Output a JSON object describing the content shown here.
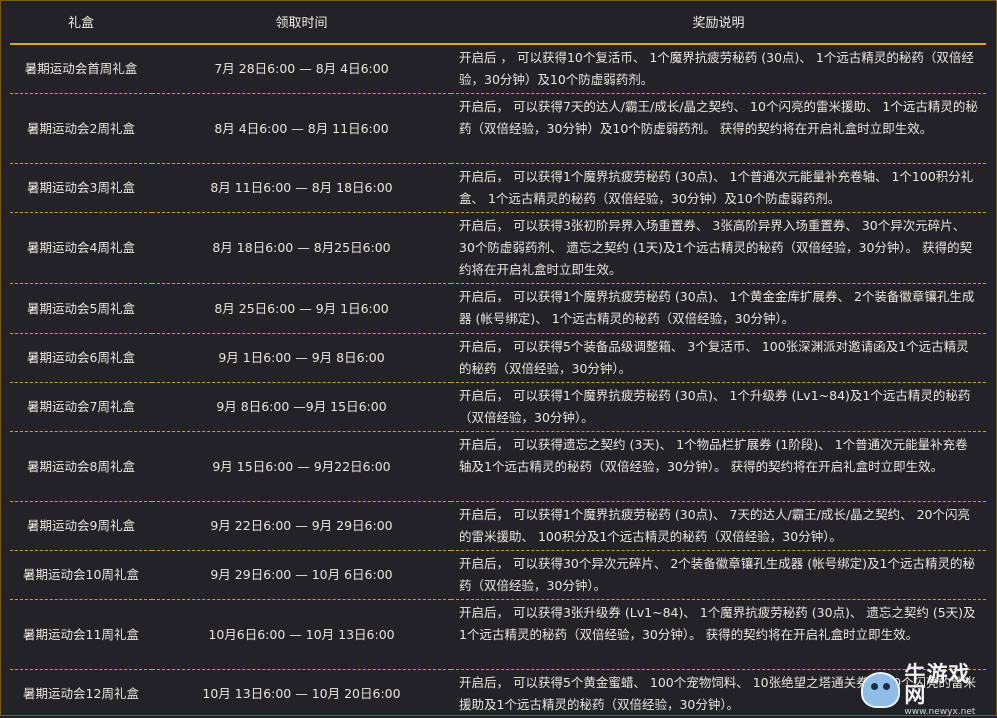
{
  "header": {
    "col_box": "礼盒",
    "col_time": "领取时间",
    "col_reward": "奖励说明"
  },
  "rows": [
    {
      "name": "暑期运动会首周礼盒",
      "time": "7月 28日6:00 — 8月 4日6:00",
      "desc": "开启后 ， 可以获得10个复活币、 1个魔界抗疲劳秘药 (30点)、 1个远古精灵的秘药（双倍经验，30分钟）及10个防虚弱药剂。"
    },
    {
      "name": "暑期运动会2周礼盒",
      "time": "8月 4日6:00 — 8月 11日6:00",
      "desc": "开启后， 可以获得7天的达人/霸王/成长/晶之契约、 10个闪亮的雷米援助、 1个远古精灵的秘药（双倍经验，30分钟）及10个防虚弱药剂。 获得的契约将在开启礼盒时立即生效。"
    },
    {
      "name": "暑期运动会3周礼盒",
      "time": "8月 11日6:00 — 8月 18日6:00",
      "desc": "开启后， 可以获得1个魔界抗疲劳秘药 (30点)、 1个普通次元能量补充卷轴、 1个100积分礼盒、 1个远古精灵的秘药（双倍经验，30分钟）及10个防虚弱药剂。"
    },
    {
      "name": "暑期运动会4周礼盒",
      "time": "8月 18日6:00 — 8月25日6:00",
      "desc": "开启后， 可以获得3张初阶异界入场重置券、 3张高阶异界入场重置券、 30个异次元碎片、 30个防虚弱药剂、 遗忘之契约 (1天)及1个远古精灵的秘药（双倍经验，30分钟）。 获得的契约将在开启礼盒时立即生效。"
    },
    {
      "name": "暑期运动会5周礼盒",
      "time": "8月 25日6:00 — 9月 1日6:00",
      "desc": "开启后， 可以获得1个魔界抗疲劳秘药 (30点)、 1个黄金金库扩展券、 2个装备徽章镶孔生成器 (帐号绑定)、 1个远古精灵的秘药（双倍经验，30分钟）。"
    },
    {
      "name": "暑期运动会6周礼盒",
      "time": "9月 1日6:00 — 9月 8日6:00",
      "desc": "开启后， 可以获得5个装备品级调整箱、 3个复活币、 100张深渊派对邀请函及1个远古精灵的秘药（双倍经验，30分钟）。"
    },
    {
      "name": "暑期运动会7周礼盒",
      "time": "9月 8日6:00 —9月 15日6:00",
      "desc": "开启后， 可以获得1个魔界抗疲劳秘药 (30点)、 1个升级券 (Lv1~84)及1个远古精灵的秘药（双倍经验，30分钟）。"
    },
    {
      "name": "暑期运动会8周礼盒",
      "time": "9月 15日6:00 — 9月22日6:00",
      "desc": "开启后， 可以获得遗忘之契约 (3天)、 1个物品栏扩展券 (1阶段)、 1个普通次元能量补充卷轴及1个远古精灵的秘药（双倍经验，30分钟）。 获得的契约将在开启礼盒时立即生效。"
    },
    {
      "name": "暑期运动会9周礼盒",
      "time": "9月 22日6:00 — 9月 29日6:00",
      "desc": "开启后， 可以获得1个魔界抗疲劳秘药 (30点)、 7天的达人/霸王/成长/晶之契约、 20个闪亮的雷米援助、 100积分及1个远古精灵的秘药（双倍经验，30分钟）。"
    },
    {
      "name": "暑期运动会10周礼盒",
      "time": "9月 29日6:00 — 10月 6日6:00",
      "desc": "开启后， 可以获得30个异次元碎片、 2个装备徽章镶孔生成器 (帐号绑定)及1个远古精灵的秘药（双倍经验，30分钟）。"
    },
    {
      "name": "暑期运动会11周礼盒",
      "time": "10月6日6:00 — 10月 13日6:00",
      "desc": "开启后， 可以获得3张升级券 (Lv1~84)、 1个魔界抗疲劳秘药 (30点)、 遗忘之契约 (5天)及1个远古精灵的秘药（双倍经验，30分钟）。 获得的契约将在开启礼盒时立即生效。"
    },
    {
      "name": "暑期运动会12周礼盒",
      "time": "10月 13日6:00 — 10月 20日6:00",
      "desc": "开启后， 可以获得5个黄金蜜蜡、 100个宠物饲料、 10张绝望之塔通关券、 30个闪亮的雷米援助及1个远古精灵的秘药（双倍经验，30分钟）。"
    }
  ],
  "watermark": {
    "brand": "牛游戏网",
    "url": "www.newyx.net"
  }
}
